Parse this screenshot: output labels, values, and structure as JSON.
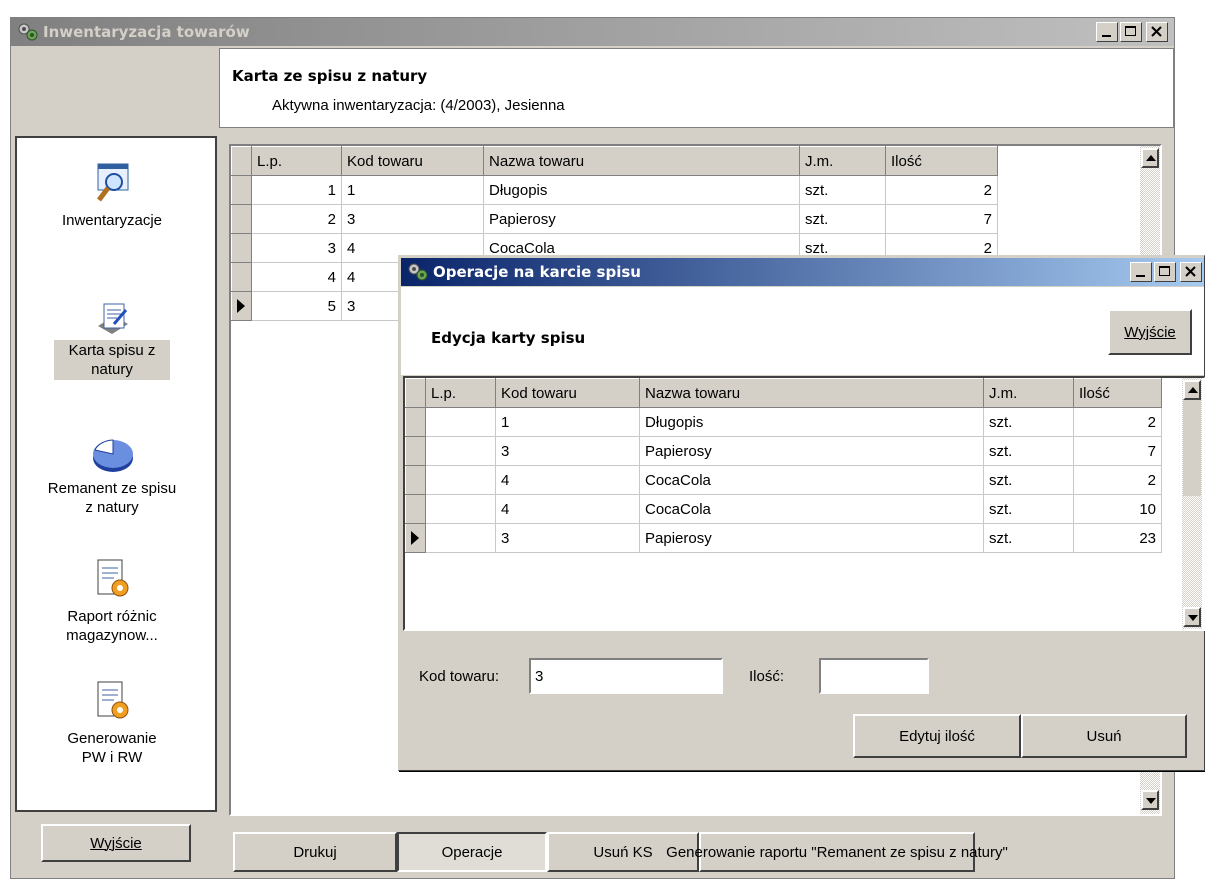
{
  "main_window": {
    "title": "Inwentaryzacja towarów",
    "header_title": "Karta ze spisu z natury",
    "header_subtitle": "Aktywna inwentaryzacja: (4/2003), Jesienna"
  },
  "sidebar": {
    "items": [
      {
        "label": "Inwentaryzacje",
        "icon": "magnifier-window-icon"
      },
      {
        "label": "Karta spisu z natury",
        "icon": "document-edit-icon",
        "selected": true
      },
      {
        "label": "Remanent ze spisu z natury",
        "icon": "pie-chart-icon"
      },
      {
        "label": "Raport różnic magazynow...",
        "icon": "report-gear-icon"
      },
      {
        "label": "Generowanie PW i RW",
        "icon": "report-gear-icon"
      }
    ],
    "exit_label": "Wyjście"
  },
  "main_grid": {
    "columns": [
      "L.p.",
      "Kod towaru",
      "Nazwa towaru",
      "J.m.",
      "Ilość"
    ],
    "rows": [
      {
        "lp": "1",
        "kod": "1",
        "nazwa": "Długopis",
        "jm": "szt.",
        "ilosc": "2"
      },
      {
        "lp": "2",
        "kod": "3",
        "nazwa": "Papierosy",
        "jm": "szt.",
        "ilosc": "7"
      },
      {
        "lp": "3",
        "kod": "4",
        "nazwa": "CocaCola",
        "jm": "szt.",
        "ilosc": "2"
      },
      {
        "lp": "4",
        "kod": "4",
        "nazwa": "",
        "jm": "",
        "ilosc": ""
      },
      {
        "lp": "5",
        "kod": "3",
        "nazwa": "",
        "jm": "",
        "ilosc": ""
      }
    ]
  },
  "bottom_buttons": {
    "drukuj": "Drukuj",
    "operacje": "Operacje",
    "usun_ks": "Usuń KS",
    "generuj": "Generowanie raportu \"Remanent ze spisu z natury\""
  },
  "dialog": {
    "title": "Operacje na karcie spisu",
    "heading": "Edycja karty spisu",
    "exit_label": "Wyjście",
    "columns": [
      "L.p.",
      "Kod towaru",
      "Nazwa towaru",
      "J.m.",
      "Ilość"
    ],
    "rows": [
      {
        "lp": "",
        "kod": "1",
        "nazwa": "Długopis",
        "jm": "szt.",
        "ilosc": "2"
      },
      {
        "lp": "",
        "kod": "3",
        "nazwa": "Papierosy",
        "jm": "szt.",
        "ilosc": "7"
      },
      {
        "lp": "",
        "kod": "4",
        "nazwa": "CocaCola",
        "jm": "szt.",
        "ilosc": "2"
      },
      {
        "lp": "",
        "kod": "4",
        "nazwa": "CocaCola",
        "jm": "szt.",
        "ilosc": "10"
      },
      {
        "lp": "",
        "kod": "3",
        "nazwa": "Papierosy",
        "jm": "szt.",
        "ilosc": "23"
      }
    ],
    "kod_label": "Kod towaru:",
    "kod_value": "3",
    "ilosc_label": "Ilość:",
    "ilosc_value": "",
    "edit_button": "Edytuj ilość",
    "delete_button": "Usuń"
  },
  "colors": {
    "face": "#d4d0c8",
    "active_title": "#0a246a",
    "inactive_title": "#808080"
  }
}
